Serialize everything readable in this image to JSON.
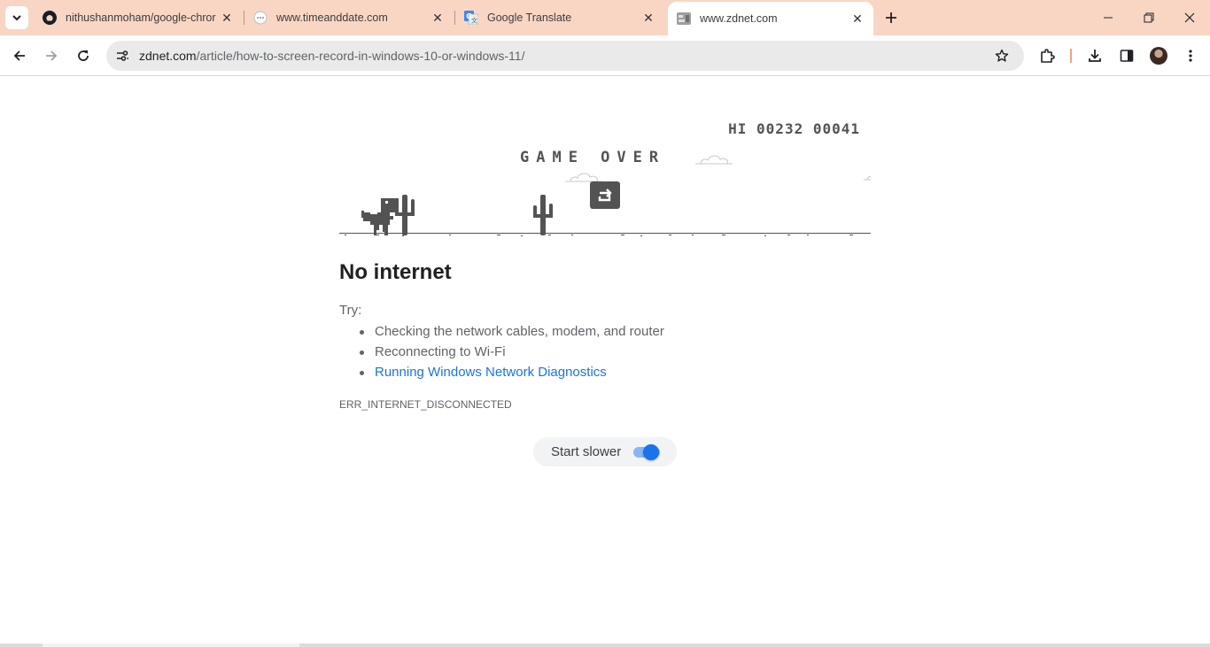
{
  "tabs": [
    {
      "title": "nithushanmoham/google-chror",
      "favicon": "github-icon"
    },
    {
      "title": "www.timeanddate.com",
      "favicon": "timeanddate-icon"
    },
    {
      "title": "Google Translate",
      "favicon": "google-translate-icon"
    },
    {
      "title": "www.zdnet.com",
      "favicon": "zdnet-icon",
      "active": true
    }
  ],
  "address_bar": {
    "host": "zdnet.com",
    "path": "/article/how-to-screen-record-in-windows-10-or-windows-11/"
  },
  "game": {
    "score": "HI 00232 00041",
    "game_over": "GAME OVER"
  },
  "error": {
    "heading": "No internet",
    "try_label": "Try:",
    "suggestions": [
      "Checking the network cables, modem, and router",
      "Reconnecting to Wi-Fi",
      "Running Windows Network Diagnostics"
    ],
    "code": "ERR_INTERNET_DISCONNECTED"
  },
  "slower_toggle": {
    "label": "Start slower",
    "on": true
  },
  "colors": {
    "tabstrip_bg": "#f9d6c4",
    "accent": "#1a73e8",
    "game_ink": "#535353"
  }
}
